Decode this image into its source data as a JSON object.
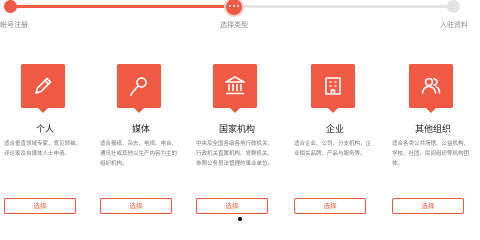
{
  "stepper": {
    "steps": [
      {
        "label": "帐号注册"
      },
      {
        "label": "选择类型"
      },
      {
        "label": "入驻资料"
      }
    ]
  },
  "cards": [
    {
      "icon": "pen-icon",
      "title": "个人",
      "desc": "适合垂直领域专家、意见领袖、评论家及自媒体人士申请。",
      "button": "选择"
    },
    {
      "icon": "microphone-icon",
      "title": "媒体",
      "desc": "适合报纸、杂志、电视、电台，通讯社或其他以生产内容为主的组织机构。",
      "button": "选择"
    },
    {
      "icon": "institution-icon",
      "title": "国家机构",
      "desc": "中央及全国各级各地行政机关、行政机关直属机构、党群机关、参照公务员法管理的事业单位。",
      "button": "选择"
    },
    {
      "icon": "building-icon",
      "title": "企业",
      "desc": "适合企业、公司，分支机构，企业相关品牌、产品与服务等。",
      "button": "选择"
    },
    {
      "icon": "people-icon",
      "title": "其他组织",
      "desc": "适合各类公共场馆、公益机构、学校、社团、民间组织等机构团体。",
      "button": "选择"
    }
  ],
  "colors": {
    "accent": "#f05a45",
    "idle": "#e3e3e3"
  }
}
